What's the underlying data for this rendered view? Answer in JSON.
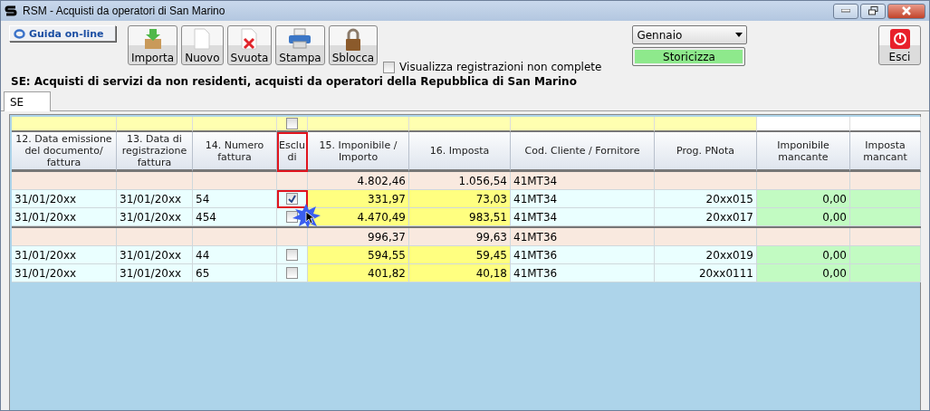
{
  "window": {
    "title": "RSM - Acquisti da operatori di San Marino"
  },
  "help_button": "Guida on-line",
  "toolbar": [
    {
      "label": "Importa",
      "kind": "import"
    },
    {
      "label": "Nuovo",
      "kind": "new"
    },
    {
      "label": "Svuota",
      "kind": "clear"
    },
    {
      "label": "Stampa",
      "kind": "print"
    },
    {
      "label": "Sblocca",
      "kind": "unlock"
    }
  ],
  "incomplete_toggle": {
    "label": "Visualizza registrazioni non complete",
    "checked": false
  },
  "month_select": {
    "value": "Gennaio"
  },
  "archive_button": "Storicizza",
  "exit_button": "Esci",
  "section_title": "SE: Acquisti di servizi da non residenti, acquisti da operatori della Repubblica di San Marino",
  "tabs": [
    {
      "label": "SE",
      "selected": true
    }
  ],
  "table": {
    "select_all_checked": false,
    "columns": [
      {
        "label": "12. Data emissione del documento/ fattura",
        "highlighted": false
      },
      {
        "label": "13. Data di registrazione fattura",
        "highlighted": false
      },
      {
        "label": "14. Numero fattura",
        "highlighted": false
      },
      {
        "label": "Esclu di",
        "highlighted": true
      },
      {
        "label": "15. Imponibile / Importo",
        "highlighted": false
      },
      {
        "label": "16. Imposta",
        "highlighted": false
      },
      {
        "label": "Cod. Cliente / Fornitore",
        "highlighted": false
      },
      {
        "label": "Prog. PNota",
        "highlighted": false
      },
      {
        "label": "Imponibile mancante",
        "highlighted": false
      },
      {
        "label": "Imposta mancant",
        "highlighted": false
      }
    ],
    "groups": [
      {
        "imponibile": "4.802,46",
        "imposta": "1.056,54",
        "code": "41MT34",
        "rows": [
          {
            "date_issue": "31/01/20xx",
            "date_reg": "31/01/20xx",
            "number": "54",
            "excluded": true,
            "highlighted": true,
            "imponibile": "331,97",
            "imposta": "73,03",
            "code": "41MT34",
            "pnota": "20xx015",
            "missing_imponibile": "0,00"
          },
          {
            "date_issue": "31/01/20xx",
            "date_reg": "31/01/20xx",
            "number": "454",
            "excluded": false,
            "highlighted": false,
            "imponibile": "4.470,49",
            "imposta": "983,51",
            "code": "41MT34",
            "pnota": "20xx017",
            "missing_imponibile": "0,00"
          }
        ]
      },
      {
        "imponibile": "996,37",
        "imposta": "99,63",
        "code": "41MT36",
        "rows": [
          {
            "date_issue": "31/01/20xx",
            "date_reg": "31/01/20xx",
            "number": "44",
            "excluded": false,
            "highlighted": false,
            "imponibile": "594,55",
            "imposta": "59,45",
            "code": "41MT36",
            "pnota": "20xx019",
            "missing_imponibile": "0,00"
          },
          {
            "date_issue": "31/01/20xx",
            "date_reg": "31/01/20xx",
            "number": "65",
            "excluded": false,
            "highlighted": false,
            "imponibile": "401,82",
            "imposta": "40,18",
            "code": "41MT36",
            "pnota": "20xx0111",
            "missing_imponibile": "0,00"
          }
        ]
      }
    ]
  }
}
